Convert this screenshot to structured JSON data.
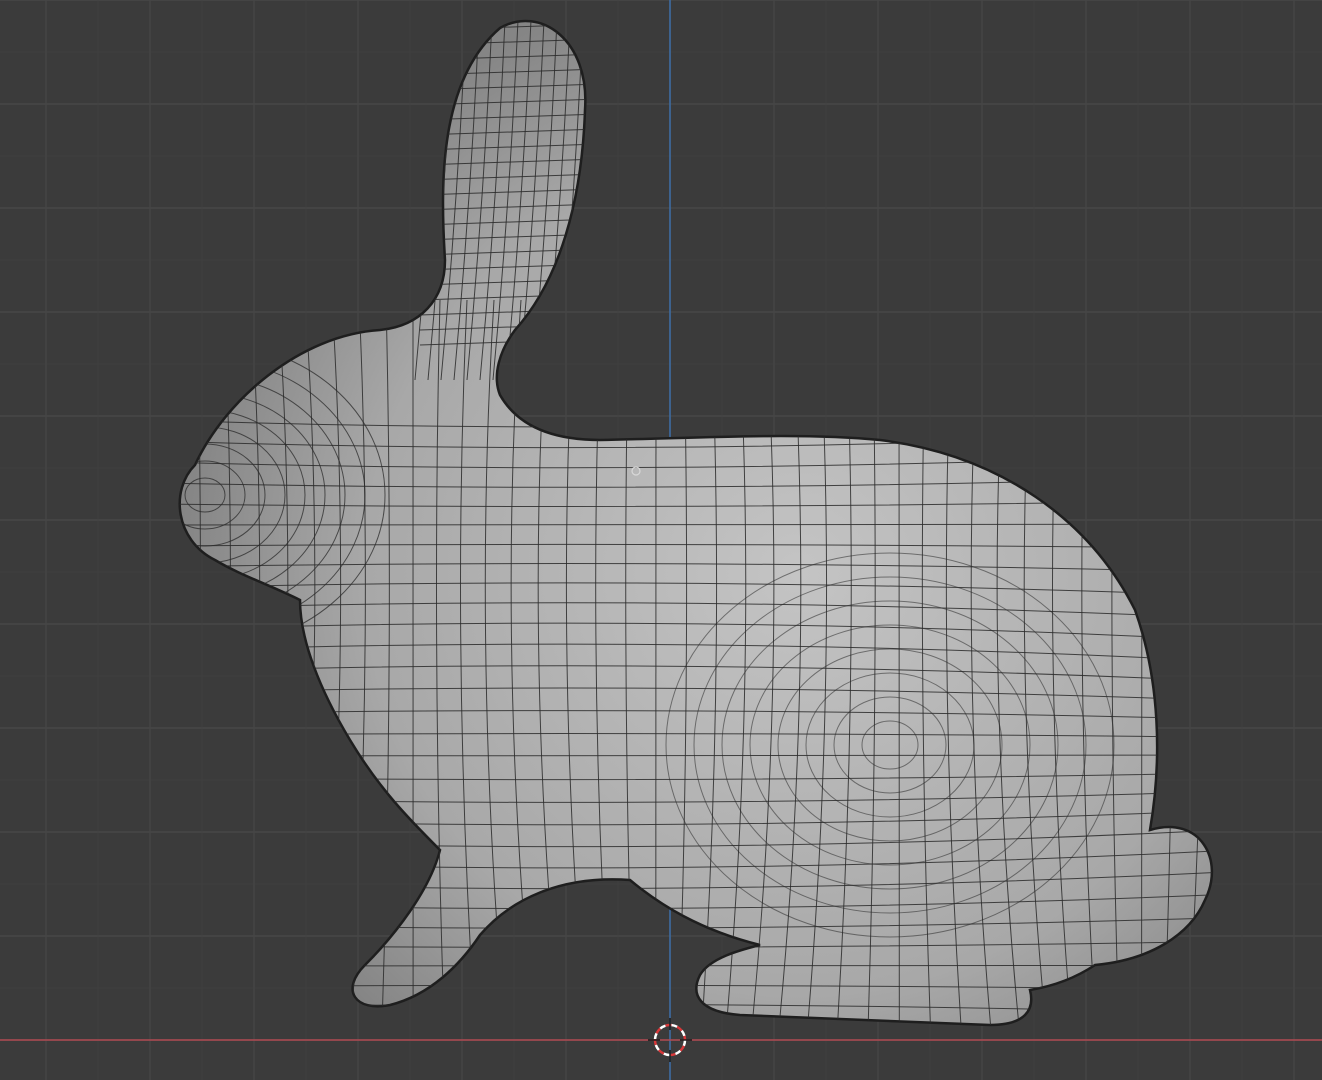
{
  "viewport": {
    "mode": "3d-viewport",
    "shading": "solid",
    "overlay": "wireframe-edges",
    "object": "bunny-mesh",
    "origin_marker_icon": "origin-dot-icon",
    "cursor_icon": "3d-cursor-icon"
  },
  "colors": {
    "background": "#3b3b3b",
    "grid_minor": "#444444",
    "grid_major": "#4c4c4c",
    "axis_x": "#b04a52",
    "axis_z": "#3d6fa8",
    "mesh_fill": "#a9a9a9",
    "mesh_wire": "#2a2a2a"
  }
}
